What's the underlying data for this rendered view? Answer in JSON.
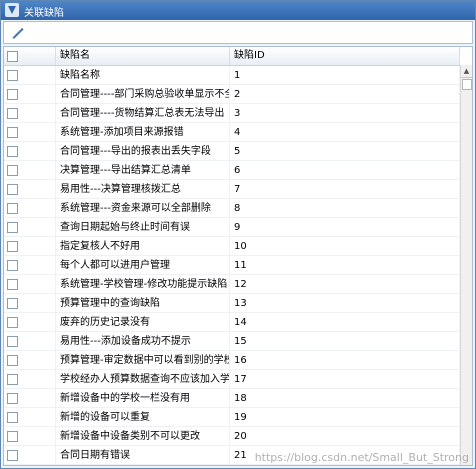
{
  "window": {
    "title": "关联缺陷"
  },
  "toolbar": {
    "icon": "pencil-icon"
  },
  "columns": {
    "name": "缺陷名",
    "id": "缺陷ID"
  },
  "rows": [
    {
      "name": "缺陷名称",
      "id": "1"
    },
    {
      "name": "合同管理----部门采购总验收单显示不全",
      "id": "2"
    },
    {
      "name": "合同管理----货物结算汇总表无法导出",
      "id": "3"
    },
    {
      "name": "系统管理-添加项目来源报错",
      "id": "4"
    },
    {
      "name": "合同管理---导出的报表出丢失字段",
      "id": "5"
    },
    {
      "name": "决算管理---导出结算汇总清单",
      "id": "6"
    },
    {
      "name": "易用性---决算管理核拨汇总",
      "id": "7"
    },
    {
      "name": "系统管理---资金来源可以全部删除",
      "id": "8"
    },
    {
      "name": "查询日期起始与终止时间有误",
      "id": "9"
    },
    {
      "name": "指定复核人不好用",
      "id": "10"
    },
    {
      "name": "每个人都可以进用户管理",
      "id": "11"
    },
    {
      "name": "系统管理-学校管理-修改功能提示缺陷",
      "id": "12"
    },
    {
      "name": "预算管理中的查询缺陷",
      "id": "13"
    },
    {
      "name": "废弃的历史记录没有",
      "id": "14"
    },
    {
      "name": "易用性---添加设备成功不提示",
      "id": "15"
    },
    {
      "name": "预算管理-审定数据中可以看到别的学校",
      "id": "16"
    },
    {
      "name": "学校经办人预算数据查询不应该加入学校",
      "id": "17"
    },
    {
      "name": "新增设备中的学校一栏没有用",
      "id": "18"
    },
    {
      "name": "新增的设备可以重复",
      "id": "19"
    },
    {
      "name": "新增设备中设备类别不可以更改",
      "id": "20"
    },
    {
      "name": "合同日期有错误",
      "id": "21"
    }
  ],
  "watermark": "https://blog.csdn.net/Small_But_Strong",
  "colors": {
    "titlebar": "#2f64aa",
    "border": "#a9bed8"
  }
}
